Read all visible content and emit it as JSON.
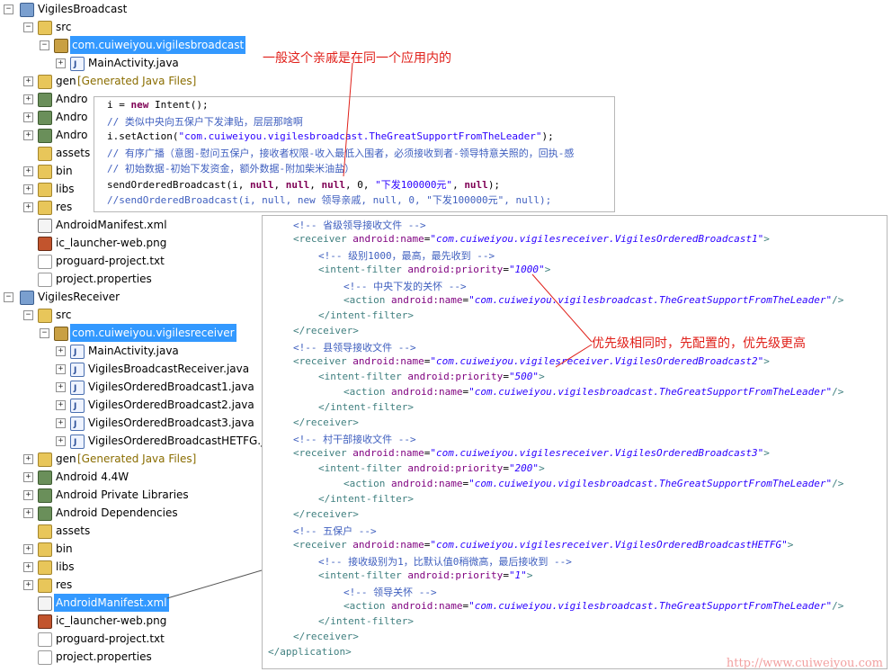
{
  "tree": [
    {
      "label": "VigilesBroadcast",
      "icon": "project",
      "toggle": "-",
      "depth": 0
    },
    {
      "label": "src",
      "icon": "folder",
      "toggle": "-",
      "depth": 1
    },
    {
      "label": "com.cuiweiyou.vigilesbroadcast",
      "icon": "package",
      "toggle": "-",
      "depth": 2,
      "selected": true
    },
    {
      "label": "MainActivity.java",
      "icon": "java",
      "toggle": "+",
      "depth": 3
    },
    {
      "label": "gen",
      "suffix": "[Generated Java Files]",
      "icon": "folder",
      "toggle": "+",
      "depth": 1
    },
    {
      "label": "Andro",
      "icon": "library",
      "toggle": "+",
      "depth": 1
    },
    {
      "label": "Andro",
      "icon": "library",
      "toggle": "+",
      "depth": 1
    },
    {
      "label": "Andro",
      "icon": "library",
      "toggle": "+",
      "depth": 1
    },
    {
      "label": "assets",
      "icon": "folder",
      "toggle": "",
      "depth": 1
    },
    {
      "label": "bin",
      "icon": "folder",
      "toggle": "+",
      "depth": 1
    },
    {
      "label": "libs",
      "icon": "folder",
      "toggle": "+",
      "depth": 1
    },
    {
      "label": "res",
      "icon": "folder",
      "toggle": "+",
      "depth": 1
    },
    {
      "label": "AndroidManifest.xml",
      "icon": "xml",
      "toggle": "",
      "depth": 1
    },
    {
      "label": "ic_launcher-web.png",
      "icon": "png",
      "toggle": "",
      "depth": 1
    },
    {
      "label": "proguard-project.txt",
      "icon": "txt",
      "toggle": "",
      "depth": 1
    },
    {
      "label": "project.properties",
      "icon": "txt",
      "toggle": "",
      "depth": 1
    },
    {
      "label": "VigilesReceiver",
      "icon": "project",
      "toggle": "-",
      "depth": 0
    },
    {
      "label": "src",
      "icon": "folder",
      "toggle": "-",
      "depth": 1
    },
    {
      "label": "com.cuiweiyou.vigilesreceiver",
      "icon": "package",
      "toggle": "-",
      "depth": 2,
      "selected": true
    },
    {
      "label": "MainActivity.java",
      "icon": "java",
      "toggle": "+",
      "depth": 3
    },
    {
      "label": "VigilesBroadcastReceiver.java",
      "icon": "java",
      "toggle": "+",
      "depth": 3
    },
    {
      "label": "VigilesOrderedBroadcast1.java",
      "icon": "java",
      "toggle": "+",
      "depth": 3
    },
    {
      "label": "VigilesOrderedBroadcast2.java",
      "icon": "java",
      "toggle": "+",
      "depth": 3
    },
    {
      "label": "VigilesOrderedBroadcast3.java",
      "icon": "java",
      "toggle": "+",
      "depth": 3
    },
    {
      "label": "VigilesOrderedBroadcastHETFG.ja",
      "icon": "java",
      "toggle": "+",
      "depth": 3
    },
    {
      "label": "gen",
      "suffix": "[Generated Java Files]",
      "icon": "folder",
      "toggle": "+",
      "depth": 1
    },
    {
      "label": "Android 4.4W",
      "icon": "library",
      "toggle": "+",
      "depth": 1
    },
    {
      "label": "Android Private Libraries",
      "icon": "library",
      "toggle": "+",
      "depth": 1
    },
    {
      "label": "Android Dependencies",
      "icon": "library",
      "toggle": "+",
      "depth": 1
    },
    {
      "label": "assets",
      "icon": "folder",
      "toggle": "",
      "depth": 1
    },
    {
      "label": "bin",
      "icon": "folder",
      "toggle": "+",
      "depth": 1
    },
    {
      "label": "libs",
      "icon": "folder",
      "toggle": "+",
      "depth": 1
    },
    {
      "label": "res",
      "icon": "folder",
      "toggle": "+",
      "depth": 1
    },
    {
      "label": "AndroidManifest.xml",
      "icon": "xml",
      "toggle": "",
      "depth": 1,
      "selected": true
    },
    {
      "label": "ic_launcher-web.png",
      "icon": "png",
      "toggle": "",
      "depth": 1
    },
    {
      "label": "proguard-project.txt",
      "icon": "txt",
      "toggle": "",
      "depth": 1
    },
    {
      "label": "project.properties",
      "icon": "txt",
      "toggle": "",
      "depth": 1
    }
  ],
  "java_code": [
    [
      {
        "t": "i = ",
        "c": ""
      },
      {
        "t": "new",
        "c": "kw"
      },
      {
        "t": " Intent();",
        "c": ""
      }
    ],
    [
      {
        "t": "// 类似中央向五保户下发津贴，层层那啥啊",
        "c": "com"
      }
    ],
    [
      {
        "t": "i.setAction(",
        "c": ""
      },
      {
        "t": "\"com.cuiweiyou.vigilesbroadcast.TheGreatSupportFromTheLeader\"",
        "c": "str"
      },
      {
        "t": ");",
        "c": ""
      }
    ],
    [
      {
        "t": "// 有序广播（意图-慰问五保户，接收者权限-收入最低入围者，必须接收到者-领导特意关照的，回执-感",
        "c": "com"
      }
    ],
    [
      {
        "t": "// 初始数据-初始下发资金，额外数据-附加柴米油盐）",
        "c": "com"
      }
    ],
    [
      {
        "t": "sendOrderedBroadcast(i, ",
        "c": ""
      },
      {
        "t": "null",
        "c": "kw"
      },
      {
        "t": ", ",
        "c": ""
      },
      {
        "t": "null",
        "c": "kw"
      },
      {
        "t": ", ",
        "c": ""
      },
      {
        "t": "null",
        "c": "kw"
      },
      {
        "t": ", 0, ",
        "c": ""
      },
      {
        "t": "\"下发100000元\"",
        "c": "str"
      },
      {
        "t": ", ",
        "c": ""
      },
      {
        "t": "null",
        "c": "kw"
      },
      {
        "t": ");",
        "c": ""
      }
    ],
    [
      {
        "t": "//sendOrderedBroadcast(i, null, new 领导亲戚, null, 0, \"下发100000元\", null);",
        "c": "com"
      }
    ]
  ],
  "xml_code": [
    {
      "indent": 1,
      "parts": [
        {
          "t": "<!-- 省级领导接收文件 -->",
          "c": "xcom"
        }
      ]
    },
    {
      "indent": 1,
      "parts": [
        {
          "t": "<receiver ",
          "c": "tag"
        },
        {
          "t": "android:name",
          "c": "attr"
        },
        {
          "t": "=",
          "c": ""
        },
        {
          "t": "\"com.cuiweiyou.vigilesreceiver.VigilesOrderedBroadcast1\"",
          "c": "val"
        },
        {
          "t": ">",
          "c": "tag"
        }
      ]
    },
    {
      "indent": 2,
      "parts": [
        {
          "t": "<!-- 级别1000，最高，最先收到 -->",
          "c": "xcom"
        }
      ]
    },
    {
      "indent": 2,
      "parts": [
        {
          "t": "<intent-filter ",
          "c": "tag"
        },
        {
          "t": "android:priority",
          "c": "attr"
        },
        {
          "t": "=",
          "c": ""
        },
        {
          "t": "\"1000\"",
          "c": "val"
        },
        {
          "t": ">",
          "c": "tag"
        }
      ]
    },
    {
      "indent": 3,
      "parts": [
        {
          "t": "<!-- 中央下发的关怀 -->",
          "c": "xcom"
        }
      ]
    },
    {
      "indent": 3,
      "parts": [
        {
          "t": "<action ",
          "c": "tag"
        },
        {
          "t": "android:name",
          "c": "attr"
        },
        {
          "t": "=",
          "c": ""
        },
        {
          "t": "\"com.cuiweiyou.vigilesbroadcast.TheGreatSupportFromTheLeader\"",
          "c": "val"
        },
        {
          "t": "/>",
          "c": "tag"
        }
      ]
    },
    {
      "indent": 2,
      "parts": [
        {
          "t": "</intent-filter>",
          "c": "tag"
        }
      ]
    },
    {
      "indent": 1,
      "parts": [
        {
          "t": "</receiver>",
          "c": "tag"
        }
      ]
    },
    {
      "indent": 1,
      "parts": [
        {
          "t": "<!-- 县领导接收文件 -->",
          "c": "xcom"
        }
      ]
    },
    {
      "indent": 1,
      "parts": [
        {
          "t": "<receiver ",
          "c": "tag"
        },
        {
          "t": "android:name",
          "c": "attr"
        },
        {
          "t": "=",
          "c": ""
        },
        {
          "t": "\"com.cuiweiyou.vigilesreceiver.VigilesOrderedBroadcast2\"",
          "c": "val"
        },
        {
          "t": ">",
          "c": "tag"
        }
      ]
    },
    {
      "indent": 2,
      "parts": [
        {
          "t": "<intent-filter ",
          "c": "tag"
        },
        {
          "t": "android:priority",
          "c": "attr"
        },
        {
          "t": "=",
          "c": ""
        },
        {
          "t": "\"500\"",
          "c": "val"
        },
        {
          "t": ">",
          "c": "tag"
        }
      ]
    },
    {
      "indent": 3,
      "parts": [
        {
          "t": "<action ",
          "c": "tag"
        },
        {
          "t": "android:name",
          "c": "attr"
        },
        {
          "t": "=",
          "c": ""
        },
        {
          "t": "\"com.cuiweiyou.vigilesbroadcast.TheGreatSupportFromTheLeader\"",
          "c": "val"
        },
        {
          "t": "/>",
          "c": "tag"
        }
      ]
    },
    {
      "indent": 2,
      "parts": [
        {
          "t": "</intent-filter>",
          "c": "tag"
        }
      ]
    },
    {
      "indent": 1,
      "parts": [
        {
          "t": "</receiver>",
          "c": "tag"
        }
      ]
    },
    {
      "indent": 1,
      "parts": [
        {
          "t": "<!-- 村干部接收文件 -->",
          "c": "xcom"
        }
      ]
    },
    {
      "indent": 1,
      "parts": [
        {
          "t": "<receiver ",
          "c": "tag"
        },
        {
          "t": "android:name",
          "c": "attr"
        },
        {
          "t": "=",
          "c": ""
        },
        {
          "t": "\"com.cuiweiyou.vigilesreceiver.VigilesOrderedBroadcast3\"",
          "c": "val"
        },
        {
          "t": ">",
          "c": "tag"
        }
      ]
    },
    {
      "indent": 2,
      "parts": [
        {
          "t": "<intent-filter ",
          "c": "tag"
        },
        {
          "t": "android:priority",
          "c": "attr"
        },
        {
          "t": "=",
          "c": ""
        },
        {
          "t": "\"200\"",
          "c": "val"
        },
        {
          "t": ">",
          "c": "tag"
        }
      ]
    },
    {
      "indent": 3,
      "parts": [
        {
          "t": "<action ",
          "c": "tag"
        },
        {
          "t": "android:name",
          "c": "attr"
        },
        {
          "t": "=",
          "c": ""
        },
        {
          "t": "\"com.cuiweiyou.vigilesbroadcast.TheGreatSupportFromTheLeader\"",
          "c": "val"
        },
        {
          "t": "/>",
          "c": "tag"
        }
      ]
    },
    {
      "indent": 2,
      "parts": [
        {
          "t": "</intent-filter>",
          "c": "tag"
        }
      ]
    },
    {
      "indent": 1,
      "parts": [
        {
          "t": "</receiver>",
          "c": "tag"
        }
      ]
    },
    {
      "indent": 1,
      "parts": [
        {
          "t": "<!-- 五保户 -->",
          "c": "xcom"
        }
      ]
    },
    {
      "indent": 1,
      "parts": [
        {
          "t": "<receiver ",
          "c": "tag"
        },
        {
          "t": "android:name",
          "c": "attr"
        },
        {
          "t": "=",
          "c": ""
        },
        {
          "t": "\"com.cuiweiyou.vigilesreceiver.VigilesOrderedBroadcastHETFG\"",
          "c": "val"
        },
        {
          "t": ">",
          "c": "tag"
        }
      ]
    },
    {
      "indent": 2,
      "parts": [
        {
          "t": "<!-- 接收级别为1，比默认值0稍微高，最后接收到 -->",
          "c": "xcom"
        }
      ]
    },
    {
      "indent": 2,
      "parts": [
        {
          "t": "<intent-filter ",
          "c": "tag"
        },
        {
          "t": "android:priority",
          "c": "attr"
        },
        {
          "t": "=",
          "c": ""
        },
        {
          "t": "\"1\"",
          "c": "val"
        },
        {
          "t": ">",
          "c": "tag"
        }
      ]
    },
    {
      "indent": 3,
      "parts": [
        {
          "t": "<!-- 领导关怀 -->",
          "c": "xcom"
        }
      ]
    },
    {
      "indent": 3,
      "parts": [
        {
          "t": "<action ",
          "c": "tag"
        },
        {
          "t": "android:name",
          "c": "attr"
        },
        {
          "t": "=",
          "c": ""
        },
        {
          "t": "\"com.cuiweiyou.vigilesbroadcast.TheGreatSupportFromTheLeader\"",
          "c": "val"
        },
        {
          "t": "/>",
          "c": "tag"
        }
      ]
    },
    {
      "indent": 2,
      "parts": [
        {
          "t": "</intent-filter>",
          "c": "tag"
        }
      ]
    },
    {
      "indent": 1,
      "parts": [
        {
          "t": "</receiver>",
          "c": "tag"
        }
      ]
    },
    {
      "indent": 0,
      "parts": [
        {
          "t": "</application>",
          "c": "tag"
        }
      ]
    }
  ],
  "annotations": {
    "relative_note": "一般这个亲戚是在同一个应用内的",
    "priority_note": "优先级相同时，先配置的，优先级更高"
  },
  "watermark": "http://www.cuiweiyou.com",
  "colors": {
    "selection": "#3399ff",
    "annotation": "#e0201a",
    "comment": "#3f5fbf",
    "keyword": "#7f0055",
    "string": "#2a00ff"
  }
}
